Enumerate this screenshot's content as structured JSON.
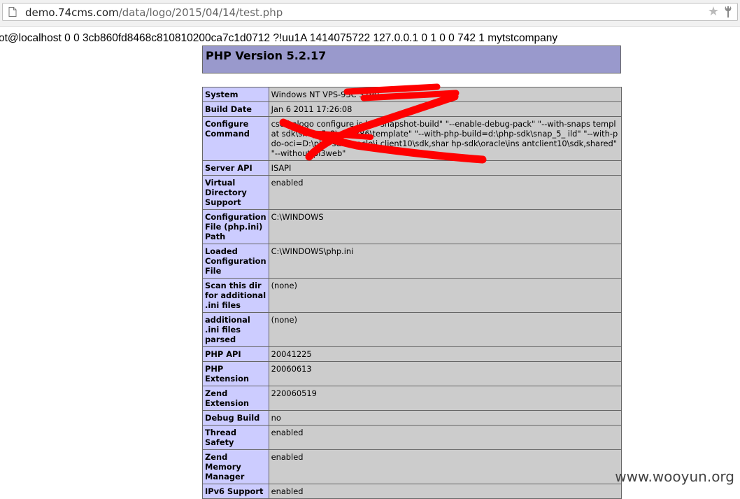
{
  "browser": {
    "url_host": "demo.74cms.com",
    "url_path": "/data/logo/2015/04/14/test.php",
    "star_icon": "star-icon",
    "menu_icon": "wrench-icon"
  },
  "leak_line": "ot@localhost 0 0 3cb860fd8468c810810200ca7c1d0712 ?!uu1A 1414075722 127.0.0.1 0 1 0 0 742 1 mytstcompany",
  "phpinfo": {
    "title": "PHP Version 5.2.17",
    "rows": [
      {
        "label": "System",
        "value": "Windows NT VPS-93C                     3790"
      },
      {
        "label": "Build Date",
        "value": "Jan 6 2011 17:26:08"
      },
      {
        "label": "Configure Command",
        "value": "cscri      ologo configure.js       ble-snapshot-build\" \"--enable-debug-pack\" \"--with-snaps      templat      sdk\\snap_5_2\\vc6\\x86\\template\" \"--with-php-build=d:\\php-sdk\\snap_5_             ild\" \"--with-pdo-oci=D:\\php-sdk\\oracle\\i     client10\\sdk,shar                  hp-sdk\\oracle\\ins antclient10\\sdk,shared\" \"--without-pi3web\""
      },
      {
        "label": "Server API",
        "value": "ISAPI"
      },
      {
        "label": "Virtual Directory Support",
        "value": "enabled"
      },
      {
        "label": "Configuration File (php.ini) Path",
        "value": "C:\\WINDOWS"
      },
      {
        "label": "Loaded Configuration File",
        "value": "C:\\WINDOWS\\php.ini"
      },
      {
        "label": "Scan this dir for additional .ini files",
        "value": "(none)"
      },
      {
        "label": "additional .ini files parsed",
        "value": "(none)"
      },
      {
        "label": "PHP API",
        "value": "20041225"
      },
      {
        "label": "PHP Extension",
        "value": "20060613"
      },
      {
        "label": "Zend Extension",
        "value": "220060519"
      },
      {
        "label": "Debug Build",
        "value": "no"
      },
      {
        "label": "Thread Safety",
        "value": "enabled"
      },
      {
        "label": "Zend Memory Manager",
        "value": "enabled"
      },
      {
        "label": "IPv6 Support",
        "value": "enabled"
      }
    ]
  },
  "watermark": "www.wooyun.org",
  "colors": {
    "header_bg": "#9999cc",
    "label_bg": "#ccccff",
    "value_bg": "#cccccc",
    "redaction": "#ff0000"
  }
}
